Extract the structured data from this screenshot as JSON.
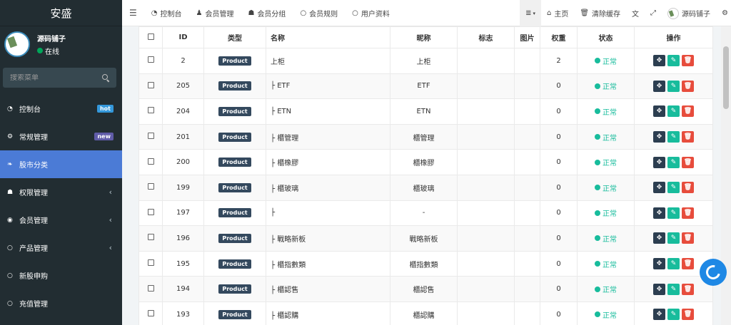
{
  "sidebar": {
    "brand": "安盛",
    "user": {
      "name": "源码铺子",
      "status": "在线"
    },
    "search_placeholder": "搜索菜单",
    "items": [
      {
        "label": "控制台",
        "icon": "dashboard-icon",
        "badge": "hot"
      },
      {
        "label": "常规管理",
        "icon": "cogs-icon",
        "badge": "new"
      },
      {
        "label": "股市分类",
        "icon": "leaf-icon",
        "active": true
      },
      {
        "label": "权限管理",
        "icon": "group-icon"
      },
      {
        "label": "会员管理",
        "icon": "user-circle-icon"
      },
      {
        "label": "产品管理",
        "icon": "circle-icon"
      },
      {
        "label": "新股申购",
        "icon": "circle-icon"
      },
      {
        "label": "充值管理",
        "icon": "circle-icon"
      }
    ]
  },
  "topnav": {
    "tabs": [
      {
        "label": "控制台",
        "icon": "dashboard-icon"
      },
      {
        "label": "会员管理",
        "icon": "user-icon"
      },
      {
        "label": "会员分组",
        "icon": "group-icon"
      },
      {
        "label": "会员规则",
        "icon": "circle-icon"
      },
      {
        "label": "用户资料",
        "icon": "circle-icon"
      }
    ],
    "home": "主页",
    "clear_cache": "清除缓存",
    "username": "源码铺子"
  },
  "table": {
    "headers": [
      "",
      "ID",
      "类型",
      "名称",
      "昵称",
      "标志",
      "图片",
      "权重",
      "状态",
      "操作"
    ],
    "rows": [
      {
        "id": "2",
        "type": "Product",
        "name": "上柜",
        "nickname": "上柜",
        "weight": "2",
        "status": "正常"
      },
      {
        "id": "205",
        "type": "Product",
        "name": "├ ETF",
        "nickname": "ETF",
        "weight": "0",
        "status": "正常"
      },
      {
        "id": "204",
        "type": "Product",
        "name": "├ ETN",
        "nickname": "ETN",
        "weight": "0",
        "status": "正常"
      },
      {
        "id": "201",
        "type": "Product",
        "name": "├ 櫃管理",
        "nickname": "櫃管理",
        "weight": "0",
        "status": "正常"
      },
      {
        "id": "200",
        "type": "Product",
        "name": "├ 櫃橡膠",
        "nickname": "櫃橡膠",
        "weight": "0",
        "status": "正常"
      },
      {
        "id": "199",
        "type": "Product",
        "name": "├ 櫃玻璃",
        "nickname": "櫃玻璃",
        "weight": "0",
        "status": "正常"
      },
      {
        "id": "197",
        "type": "Product",
        "name": "├",
        "nickname": "-",
        "weight": "0",
        "status": "正常"
      },
      {
        "id": "196",
        "type": "Product",
        "name": "├ 戰略新板",
        "nickname": "戰略新板",
        "weight": "0",
        "status": "正常"
      },
      {
        "id": "195",
        "type": "Product",
        "name": "├ 櫃指數類",
        "nickname": "櫃指數類",
        "weight": "0",
        "status": "正常"
      },
      {
        "id": "194",
        "type": "Product",
        "name": "├ 櫃認售",
        "nickname": "櫃認售",
        "weight": "0",
        "status": "正常"
      },
      {
        "id": "193",
        "type": "Product",
        "name": "├ 櫃認購",
        "nickname": "櫃認購",
        "weight": "0",
        "status": "正常"
      }
    ]
  }
}
